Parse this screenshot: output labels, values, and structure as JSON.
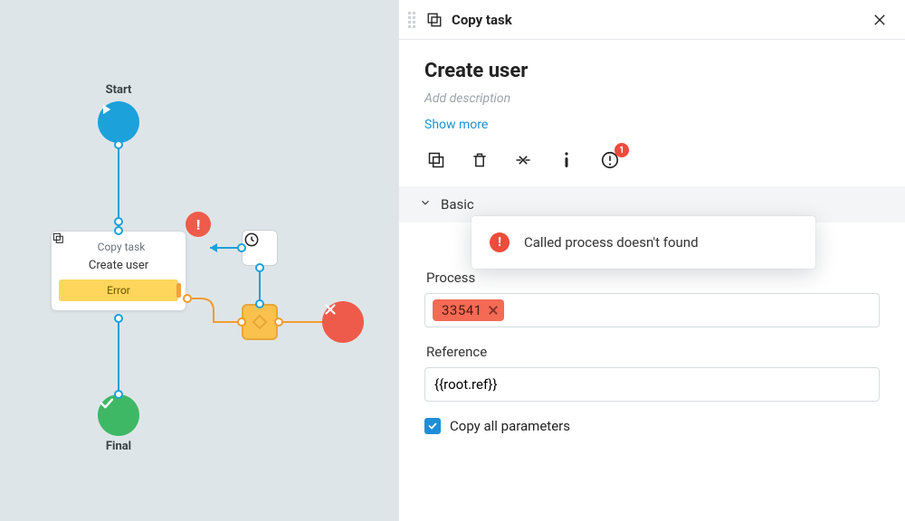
{
  "canvas": {
    "start_label": "Start",
    "final_label": "Final",
    "task_type": "Copy task",
    "task_title": "Create user",
    "task_error": "Error"
  },
  "panel": {
    "header_title": "Copy task",
    "title": "Create user",
    "description_placeholder": "Add description",
    "show_more": "Show more",
    "error_count": "1",
    "tooltip_text": "Called process doesn't found",
    "section_basic": "Basic",
    "process_label": "Process",
    "process_value": "33541",
    "reference_label": "Reference",
    "reference_value": "{{root.ref}}",
    "copy_all_label": "Copy all parameters"
  }
}
